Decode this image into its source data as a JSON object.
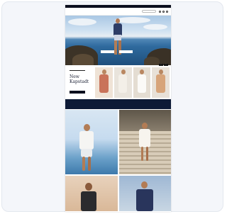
{
  "promo": {
    "text": ""
  },
  "header": {
    "logo": "",
    "nav": [
      "",
      "",
      "",
      "",
      ""
    ],
    "search_placeholder": ""
  },
  "hero": {
    "buttons": [
      "",
      ""
    ]
  },
  "new_arrivals": {
    "label": "",
    "title_line1": "New",
    "title_line2": "Kapstadt",
    "button": ""
  },
  "band": {
    "title": "",
    "subtitle": ""
  },
  "colors": {
    "navy": "#0d1a36",
    "black": "#0b0f1e",
    "frame_bg": "#f4f6fa"
  }
}
